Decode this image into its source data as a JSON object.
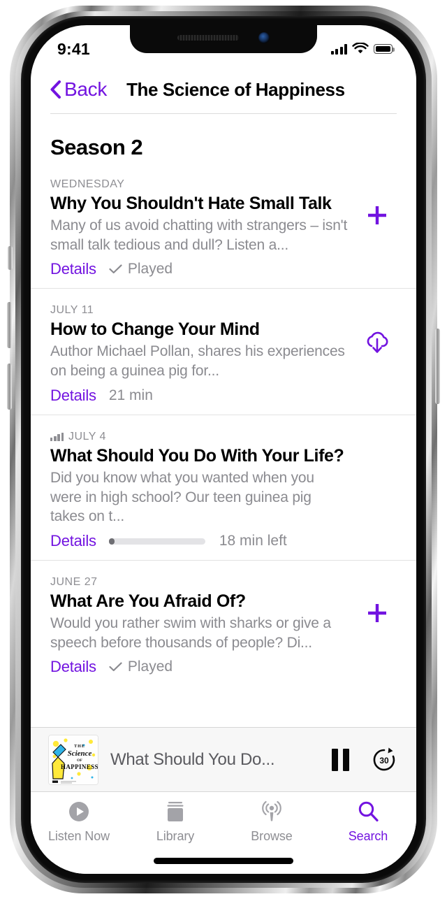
{
  "accent_color": "#7213E0",
  "status_bar": {
    "time": "9:41",
    "cellular_icon": "signal-bars-icon",
    "wifi_icon": "wifi-icon",
    "battery_icon": "battery-full-icon"
  },
  "nav": {
    "back_label": "Back",
    "back_icon": "chevron-left-icon",
    "title": "The Science of Happiness"
  },
  "section": {
    "heading": "Season 2"
  },
  "episodes": [
    {
      "date": "WEDNESDAY",
      "now_playing_indicator": false,
      "title": "Why You Shouldn't Hate Small Talk",
      "description": "Many of us avoid chatting with strangers – isn't small talk tedious and dull? Listen a...",
      "details_label": "Details",
      "status_type": "played",
      "status_label": "Played",
      "action_icon": "plus-icon"
    },
    {
      "date": "JULY 11",
      "now_playing_indicator": false,
      "title": "How to Change Your Mind",
      "description": "Author Michael Pollan, shares his experiences on being a guinea pig for...",
      "details_label": "Details",
      "status_type": "duration",
      "status_label": "21 min",
      "action_icon": "cloud-download-icon"
    },
    {
      "date": "JULY 4",
      "now_playing_indicator": true,
      "title": "What Should You Do With Your Life?",
      "description": "Did you know what you wanted  when you were in high school? Our teen guinea pig takes on t...",
      "details_label": "Details",
      "status_type": "progress",
      "status_label": "18 min left",
      "progress_percent": 6,
      "action_icon": "none"
    },
    {
      "date": "JUNE 27",
      "now_playing_indicator": false,
      "title": "What Are You Afraid Of?",
      "description": "Would you rather swim with sharks or give a speech before thousands of people? Di...",
      "details_label": "Details",
      "status_type": "played",
      "status_label": "Played",
      "action_icon": "plus-icon"
    }
  ],
  "mini_player": {
    "artwork_title": "The Science of Happiness",
    "now_playing_title": "What Should You Do...",
    "pause_icon": "pause-icon",
    "skip_forward_icon": "skip-forward-30-icon",
    "skip_forward_label": "30"
  },
  "tab_bar": {
    "tabs": [
      {
        "label": "Listen Now",
        "icon": "play-circle-icon",
        "active": false
      },
      {
        "label": "Library",
        "icon": "library-icon",
        "active": false
      },
      {
        "label": "Browse",
        "icon": "podcast-broadcast-icon",
        "active": false
      },
      {
        "label": "Search",
        "icon": "magnifier-icon",
        "active": true
      }
    ]
  }
}
